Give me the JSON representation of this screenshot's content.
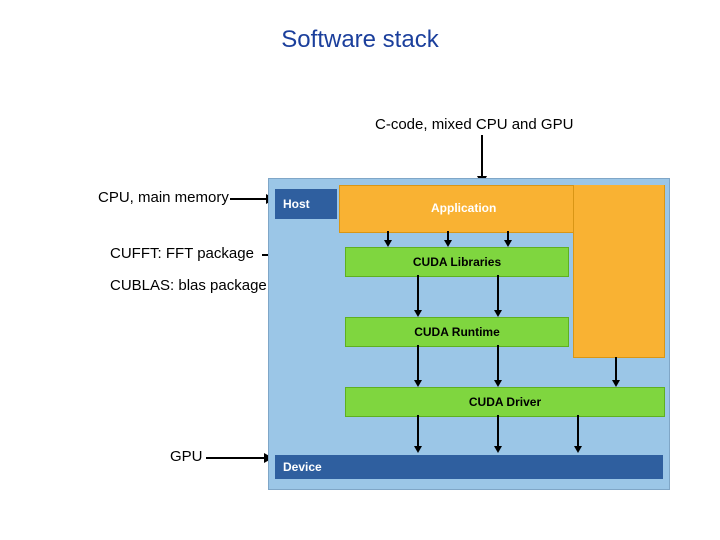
{
  "title": "Software stack",
  "annotations": {
    "top": "C-code, mixed CPU and GPU",
    "cpu": "CPU, main memory",
    "cufft": "CUFFT: FFT package",
    "cublas": "CUBLAS: blas package",
    "gpu": "GPU"
  },
  "diagram": {
    "host": "Host",
    "device": "Device",
    "application": "Application",
    "layers": [
      "CUDA Libraries",
      "CUDA Runtime",
      "CUDA Driver"
    ]
  }
}
